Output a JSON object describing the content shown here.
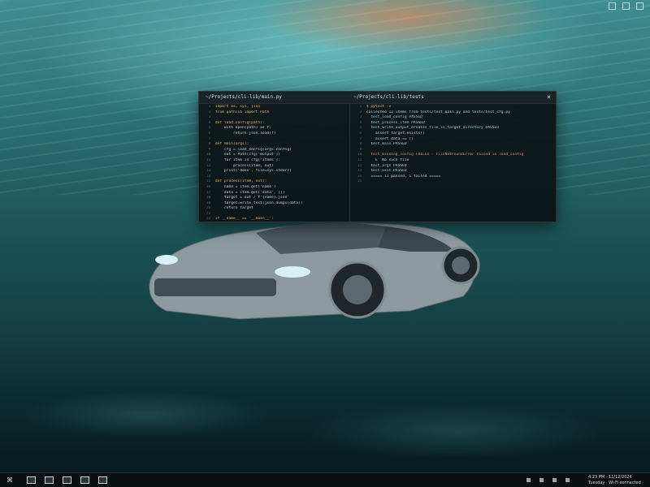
{
  "terminal": {
    "left_title": "~/Projects/cli-lib/main.py",
    "right_title": "~/Projects/cli-lib/tests",
    "close_label": "×",
    "left_lines": [
      {
        "n": "1",
        "t": "import os, sys, json"
      },
      {
        "n": "2",
        "t": "from pathlib import Path"
      },
      {
        "n": "3",
        "t": ""
      },
      {
        "n": "4",
        "t": "def load_config(path):"
      },
      {
        "n": "5",
        "t": "    with open(path) as f:"
      },
      {
        "n": "6",
        "t": "        return json.load(f)"
      },
      {
        "n": "7",
        "t": ""
      },
      {
        "n": "8",
        "t": "def main(args):"
      },
      {
        "n": "9",
        "t": "    cfg = load_config(args.config)"
      },
      {
        "n": "10",
        "t": "    out = Path(cfg['output'])"
      },
      {
        "n": "11",
        "t": "    for item in cfg['items']:"
      },
      {
        "n": "12",
        "t": "        process(item, out)"
      },
      {
        "n": "13",
        "t": "    print('done', file=sys.stderr)"
      },
      {
        "n": "14",
        "t": ""
      },
      {
        "n": "15",
        "t": "def process(item, out):"
      },
      {
        "n": "16",
        "t": "    name = item.get('name')"
      },
      {
        "n": "17",
        "t": "    data = item.get('data', [])"
      },
      {
        "n": "18",
        "t": "    target = out / f'{name}.json'"
      },
      {
        "n": "19",
        "t": "    target.write_text(json.dumps(data))"
      },
      {
        "n": "20",
        "t": "    return target"
      },
      {
        "n": "21",
        "t": ""
      },
      {
        "n": "22",
        "t": "if __name__ == '__main__':"
      },
      {
        "n": "23",
        "t": "    main(parse_args(sys.argv[1:]))"
      },
      {
        "n": "24",
        "t": "    sys.exit(0)"
      },
      {
        "n": "25",
        "t": ""
      }
    ],
    "right_lines": [
      {
        "n": "1",
        "t": "$ pytest -v"
      },
      {
        "n": "2",
        "t": "collected 12 items from tests/test_main.py and tests/test_cfg.py"
      },
      {
        "n": "3",
        "t": "  test_load_config PASSED"
      },
      {
        "n": "4",
        "t": "  test_process_item PASSED"
      },
      {
        "n": "5",
        "t": "  test_write_output_creates_file_in_target_directory PASSED"
      },
      {
        "n": "6",
        "t": "    assert target.exists()"
      },
      {
        "n": "7",
        "t": "    assert data == []"
      },
      {
        "n": "8",
        "t": "  test_main PASSED"
      },
      {
        "n": "9",
        "t": ""
      },
      {
        "n": "10",
        "t": "  test_missing_config FAILED - FileNotFoundError raised in load_config"
      },
      {
        "n": "11",
        "t": "    E  No such file"
      },
      {
        "n": "12",
        "t": "  test_args PASSED"
      },
      {
        "n": "13",
        "t": "  test_exit PASSED"
      },
      {
        "n": "14",
        "t": "  ===== 11 passed, 1 failed ====="
      },
      {
        "n": "15",
        "t": ""
      }
    ]
  },
  "taskbar": {
    "start_label": "⌘",
    "items": [
      "files",
      "terminal",
      "browser",
      "mail",
      "settings"
    ],
    "tray_time": "4:23 PM · 11/12/2024",
    "tray_date": "Tuesday · Wi-Fi connected"
  },
  "colors": {
    "water_top": "#3f8e91",
    "water_bottom": "#0b282c",
    "terminal_bg": "#0c1214",
    "taskbar_bg": "#0b1113"
  }
}
